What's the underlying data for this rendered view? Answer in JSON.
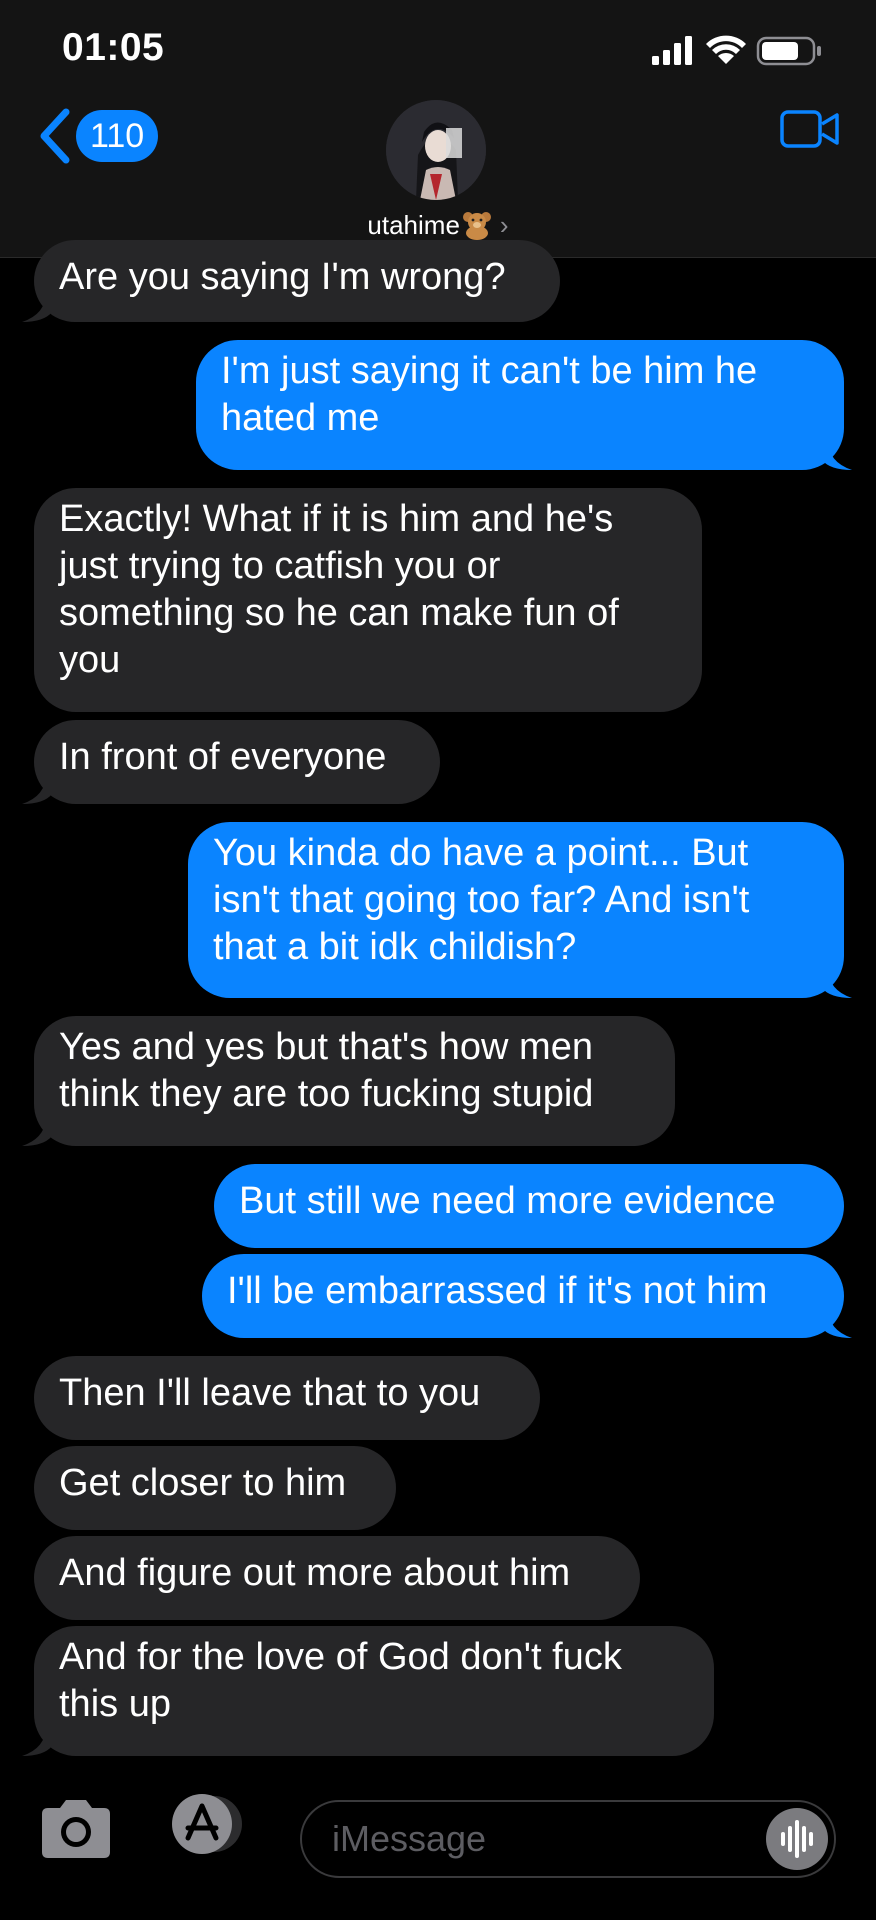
{
  "status_bar": {
    "time": "01:05",
    "icons": [
      "signal-icon",
      "wifi-icon",
      "battery-icon"
    ]
  },
  "header": {
    "back_count": "110",
    "contact_name": "utahime",
    "contact_emoji": "teddy-bear-emoji",
    "chevron": "›",
    "video_icon": "video-camera-icon"
  },
  "colors": {
    "outgoing_bubble": "#0a84ff",
    "incoming_bubble": "#262628",
    "background": "#000000",
    "header_background": "#141414"
  },
  "messages": [
    {
      "direction": "in",
      "text": "Are you saying I'm wrong?"
    },
    {
      "direction": "out",
      "text": "I'm just saying it can't be him he\nhated me"
    },
    {
      "direction": "in",
      "text": "Exactly! What if it is him and he's\njust trying to catfish you or\nsomething so he can make fun of\nyou"
    },
    {
      "direction": "in",
      "text": "In front of everyone"
    },
    {
      "direction": "out",
      "text": "You kinda do have a point... But\nisn't that going too far? And isn't\nthat a bit idk childish?"
    },
    {
      "direction": "in",
      "text": "Yes and yes but that's how men\nthink they are too fucking stupid"
    },
    {
      "direction": "out",
      "text": "But still we need more evidence"
    },
    {
      "direction": "out",
      "text": "I'll be embarrassed if it's not him"
    },
    {
      "direction": "in",
      "text": "Then I'll leave that to you"
    },
    {
      "direction": "in",
      "text": "Get closer to him"
    },
    {
      "direction": "in",
      "text": "And figure out more about him"
    },
    {
      "direction": "in",
      "text": "And for the love of God don't fuck\nthis up"
    }
  ],
  "composer": {
    "placeholder": "iMessage",
    "camera_icon": "camera-icon",
    "apps_icon": "app-store-icon",
    "audio_icon": "audio-waveform-icon"
  }
}
